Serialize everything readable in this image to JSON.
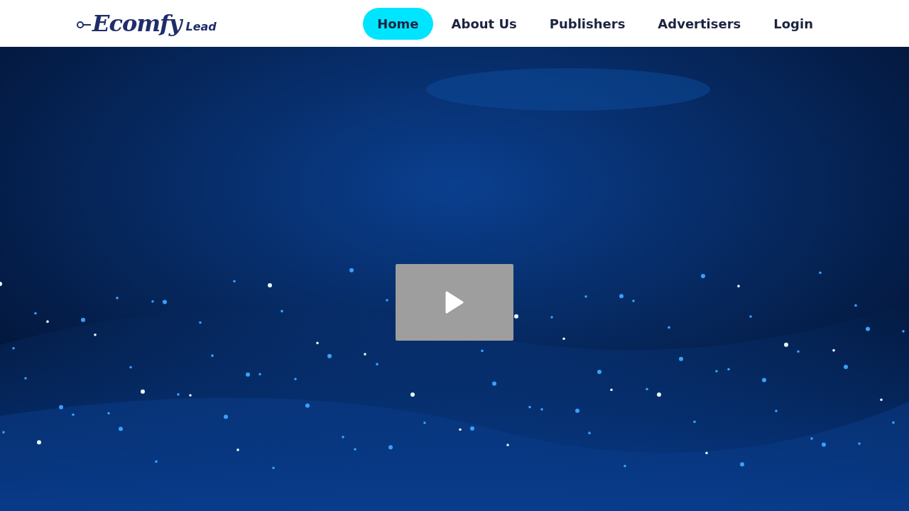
{
  "logo": {
    "name": "Ecomfy",
    "suffix": "Lead"
  },
  "nav": [
    {
      "label": "Home",
      "selected": true
    },
    {
      "label": "About Us",
      "selected": false
    },
    {
      "label": "Publishers",
      "selected": false
    },
    {
      "label": "Advertisers",
      "selected": false
    },
    {
      "label": "Login",
      "selected": false
    }
  ]
}
